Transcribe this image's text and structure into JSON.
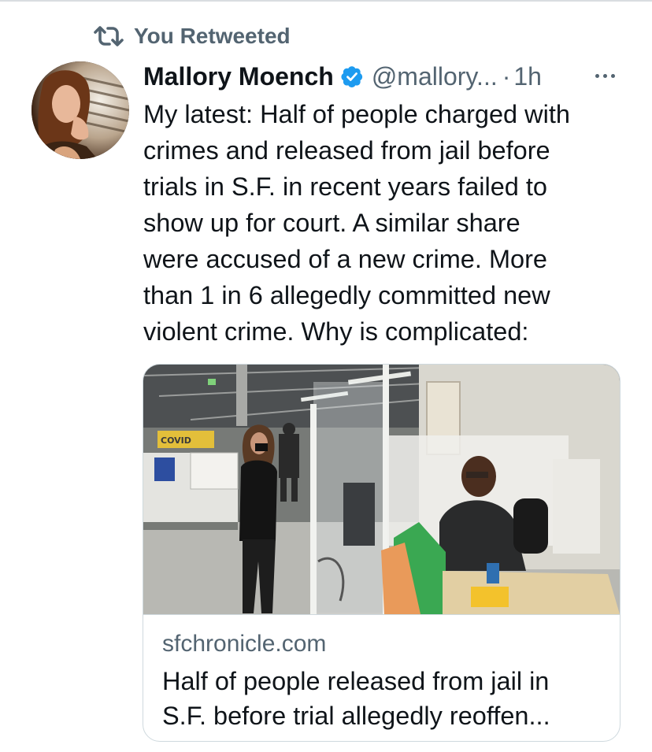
{
  "retweet": {
    "label": "You Retweeted",
    "icon": "retweet-icon"
  },
  "author": {
    "name": "Mallory Moench",
    "verified_icon": "verified-badge-icon",
    "handle": "@mallory...",
    "separator": "·",
    "time": "1h",
    "more_icon": "more-options-icon"
  },
  "tweet": {
    "text": "My latest: Half of people charged with\ncrimes and released from jail before\ntrials in S.F. in recent years failed to\nshow up for court. A similar share\nwere accused of a new crime. More\nthan 1 in 6 allegedly committed new\nviolent crime. Why is complicated:"
  },
  "card": {
    "domain": "sfchronicle.com",
    "title": "Half of people released from jail in\nS.F. before trial allegedly reoffen...",
    "image_sign_text": "COVID"
  },
  "colors": {
    "text_primary": "#0f1419",
    "text_secondary": "#536471",
    "verified_blue": "#1d9bf0",
    "card_border": "#cfd9de"
  }
}
